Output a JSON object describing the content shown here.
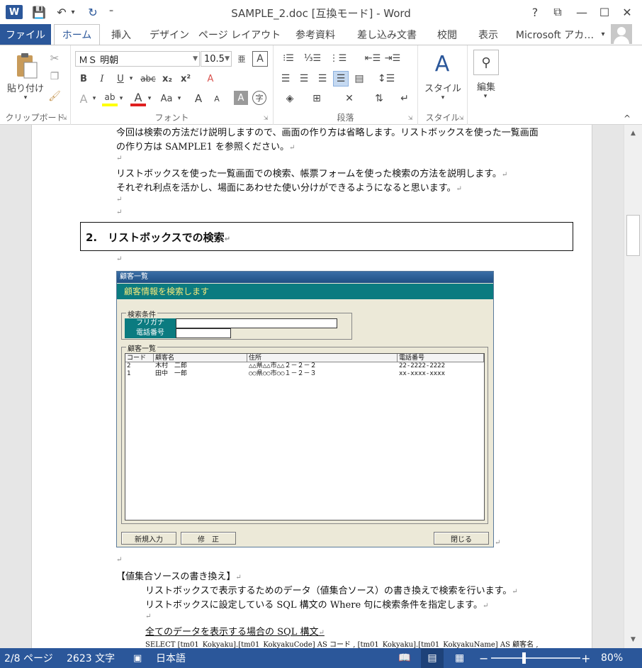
{
  "window": {
    "title": "SAMPLE_2.doc [互換モード] - Word",
    "app_logo": "W",
    "help": "?",
    "restore": "⧉",
    "minimize": "—",
    "maximize": "☐",
    "close": "✕"
  },
  "qat": {
    "save": "💾",
    "undo": "↶",
    "undo_dd": "▾",
    "redo": "↻",
    "more": "⁼"
  },
  "tabs": [
    {
      "label": "ファイル"
    },
    {
      "label": "ホーム"
    },
    {
      "label": "挿入"
    },
    {
      "label": "デザイン"
    },
    {
      "label": "ページ レイアウト"
    },
    {
      "label": "参考資料"
    },
    {
      "label": "差し込み文書"
    },
    {
      "label": "校閲"
    },
    {
      "label": "表示"
    },
    {
      "label": "Microsoft アカ…"
    }
  ],
  "account_dd": "▾",
  "ribbon": {
    "clipboard": {
      "paste": "貼り付け",
      "paste_dd": "▾",
      "label": "クリップボード"
    },
    "font": {
      "name": "ＭＳ 明朝",
      "size": "10.5",
      "bold": "B",
      "italic": "I",
      "underline": "U",
      "strike": "abc",
      "sub": "x₂",
      "sup": "x²",
      "clear": "A",
      "effects": "A",
      "highlight": "ab",
      "color": "A",
      "case": "Aa",
      "grow": "A",
      "shrink": "A",
      "shade": "A",
      "enclose": "字",
      "label": "フォント"
    },
    "paragraph": {
      "label": "段落"
    },
    "styles": {
      "button": "スタイル",
      "label": "スタイル"
    },
    "editing": {
      "button": "編集"
    },
    "collapse": "^"
  },
  "document": {
    "lines": [
      "今回は検索の方法だけ説明しますので、画面の作り方は省略します。リストボックスを使った一覧画面",
      "の作り方は SAMPLE1 を参照ください。",
      "リストボックスを使った一覧画面での検索、帳票フォームを使った検索の方法を説明します。",
      "それぞれ利点を活かし、場面にあわせた使い分けができるようになると思います。"
    ],
    "heading": "2.　リストボックスでの検索",
    "return_mark": "↵",
    "section_label": "【値集合ソースの書き換え】",
    "para1": "リストボックスで表示するためのデータ（値集合ソース）の書き換えで検索を行います。",
    "para2": "リストボックスに設定している SQL 構文の Where 句に検索条件を指定します。",
    "subheading": "全てのデータを表示する場合の SQL 構文",
    "sql": "SELECT  [tm01_Kokyaku].[tm01_KokyakuCode]  AS  コード , [tm01_Kokyaku].[tm01_KokyakuName]  AS  顧客名 ,"
  },
  "embedded_app": {
    "title": "顧客一覧",
    "header": "顧客情報を検索します",
    "cond_title": "検索条件",
    "field1": "フリガナ",
    "field2": "電話番号",
    "list_title": "顧客一覧",
    "columns": [
      "コード",
      "顧客名",
      "住所",
      "電話番号"
    ],
    "rows": [
      [
        "2",
        "木村　二郎",
        "△△県△△市△△２－２－２",
        "22-2222-2222"
      ],
      [
        "1",
        "田中　一郎",
        "○○県○○市○○１－２－３",
        "xx-xxxx-xxxx"
      ]
    ],
    "btn_new": "新規入力",
    "btn_edit": "修　正",
    "btn_close": "閉じる"
  },
  "scrollbar": {
    "up": "▲",
    "down": "▼"
  },
  "status": {
    "page": "2/8 ページ",
    "words": "2623 文字",
    "lang_icon": "▣",
    "language": "日本語",
    "zoom_minus": "−",
    "zoom_plus": "+",
    "zoom": "80%",
    "zoom_percent": 80
  }
}
